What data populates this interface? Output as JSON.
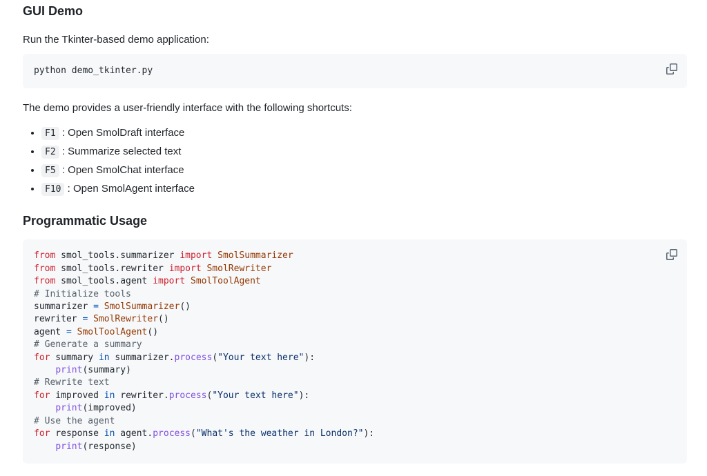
{
  "colors": {
    "text": "#1f2328",
    "code_background": "#f6f8fa",
    "icon": "#59636e",
    "syntax_keyword": "#cf222e",
    "syntax_entity": "#953800",
    "syntax_operator": "#0550ae",
    "syntax_function": "#8250df",
    "syntax_string": "#0a3069",
    "syntax_comment": "#57606a",
    "syntax_plain": "#24292f"
  },
  "sections": {
    "gui_demo": {
      "heading": "GUI Demo",
      "intro": "Run the Tkinter-based demo application:",
      "shortcuts_intro": "The demo provides a user-friendly interface with the following shortcuts:",
      "shortcuts": [
        {
          "key": "F1",
          "desc": " : Open SmolDraft interface"
        },
        {
          "key": "F2",
          "desc": " : Summarize selected text"
        },
        {
          "key": "F5",
          "desc": " : Open SmolChat interface"
        },
        {
          "key": "F10",
          "desc": " : Open SmolAgent interface"
        }
      ]
    },
    "programmatic": {
      "heading": "Programmatic Usage"
    }
  },
  "code_blocks": {
    "shell": {
      "copy_tooltip": "Copy",
      "lines": [
        [
          {
            "c": "p",
            "t": "python demo_tkinter.py"
          }
        ]
      ]
    },
    "python": {
      "copy_tooltip": "Copy",
      "lines": [
        [
          {
            "c": "k",
            "t": "from"
          },
          {
            "c": "p",
            "t": " smol_tools.summarizer "
          },
          {
            "c": "k",
            "t": "import"
          },
          {
            "c": "e",
            "t": " SmolSummarizer"
          }
        ],
        [
          {
            "c": "k",
            "t": "from"
          },
          {
            "c": "p",
            "t": " smol_tools.rewriter "
          },
          {
            "c": "k",
            "t": "import"
          },
          {
            "c": "e",
            "t": " SmolRewriter"
          }
        ],
        [
          {
            "c": "k",
            "t": "from"
          },
          {
            "c": "p",
            "t": " smol_tools.agent "
          },
          {
            "c": "k",
            "t": "import"
          },
          {
            "c": "e",
            "t": " SmolToolAgent"
          }
        ],
        [
          {
            "c": "c",
            "t": "# Initialize tools"
          }
        ],
        [
          {
            "c": "p",
            "t": "summarizer "
          },
          {
            "c": "o",
            "t": "="
          },
          {
            "c": "e",
            "t": " SmolSummarizer"
          },
          {
            "c": "p",
            "t": "()"
          }
        ],
        [
          {
            "c": "p",
            "t": "rewriter "
          },
          {
            "c": "o",
            "t": "="
          },
          {
            "c": "e",
            "t": " SmolRewriter"
          },
          {
            "c": "p",
            "t": "()"
          }
        ],
        [
          {
            "c": "p",
            "t": "agent "
          },
          {
            "c": "o",
            "t": "="
          },
          {
            "c": "e",
            "t": " SmolToolAgent"
          },
          {
            "c": "p",
            "t": "()"
          }
        ],
        [
          {
            "c": "c",
            "t": "# Generate a summary"
          }
        ],
        [
          {
            "c": "k",
            "t": "for"
          },
          {
            "c": "p",
            "t": " summary "
          },
          {
            "c": "o",
            "t": "in"
          },
          {
            "c": "p",
            "t": " summarizer."
          },
          {
            "c": "f",
            "t": "process"
          },
          {
            "c": "p",
            "t": "("
          },
          {
            "c": "s",
            "t": "\"Your text here\""
          },
          {
            "c": "p",
            "t": "):"
          }
        ],
        [
          {
            "c": "p",
            "t": "    "
          },
          {
            "c": "f",
            "t": "print"
          },
          {
            "c": "p",
            "t": "(summary)"
          }
        ],
        [
          {
            "c": "c",
            "t": "# Rewrite text"
          }
        ],
        [
          {
            "c": "k",
            "t": "for"
          },
          {
            "c": "p",
            "t": " improved "
          },
          {
            "c": "o",
            "t": "in"
          },
          {
            "c": "p",
            "t": " rewriter."
          },
          {
            "c": "f",
            "t": "process"
          },
          {
            "c": "p",
            "t": "("
          },
          {
            "c": "s",
            "t": "\"Your text here\""
          },
          {
            "c": "p",
            "t": "):"
          }
        ],
        [
          {
            "c": "p",
            "t": "    "
          },
          {
            "c": "f",
            "t": "print"
          },
          {
            "c": "p",
            "t": "(improved)"
          }
        ],
        [
          {
            "c": "c",
            "t": "# Use the agent"
          }
        ],
        [
          {
            "c": "k",
            "t": "for"
          },
          {
            "c": "p",
            "t": " response "
          },
          {
            "c": "o",
            "t": "in"
          },
          {
            "c": "p",
            "t": " agent."
          },
          {
            "c": "f",
            "t": "process"
          },
          {
            "c": "p",
            "t": "("
          },
          {
            "c": "s",
            "t": "\"What's the weather in London?\""
          },
          {
            "c": "p",
            "t": "):"
          }
        ],
        [
          {
            "c": "p",
            "t": "    "
          },
          {
            "c": "f",
            "t": "print"
          },
          {
            "c": "p",
            "t": "(response)"
          }
        ]
      ]
    }
  }
}
